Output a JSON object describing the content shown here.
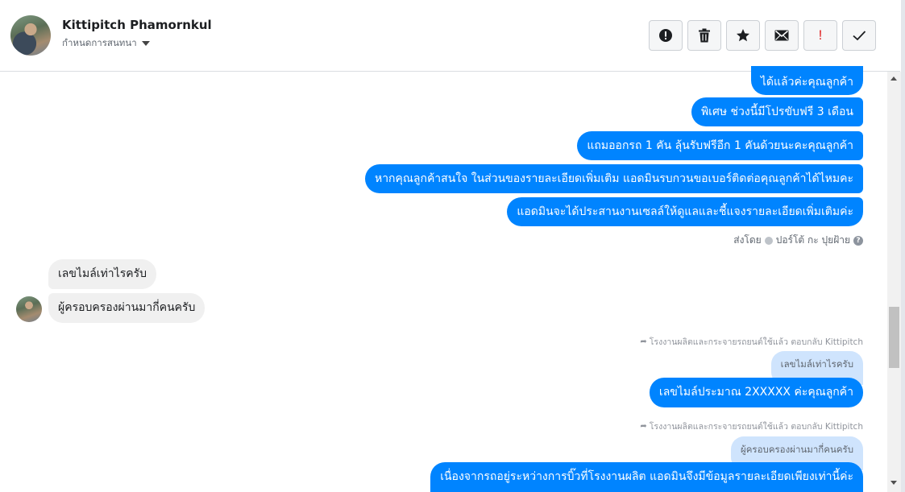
{
  "header": {
    "contact_name": "Kittipitch Phamornkul",
    "subtitle": "กำหนดการสนทนา"
  },
  "toolbar": {
    "buttons": [
      {
        "icon": "alert-circle-icon"
      },
      {
        "icon": "trash-icon"
      },
      {
        "icon": "star-icon"
      },
      {
        "icon": "envelope-icon"
      },
      {
        "icon": "exclamation-icon",
        "label": "!",
        "color": "#e02020"
      },
      {
        "icon": "checkmark-icon"
      }
    ]
  },
  "messages": {
    "outgoing_1": "ได้แล้วค่ะคุณลูกค้า",
    "outgoing_2": "พิเศษ ช่วงนี้มีโปรขับฟรี 3 เดือน",
    "outgoing_3": "แถมออกรถ 1 คัน ลุ้นรับฟรีอีก 1 คันด้วยนะคะคุณลูกค้า",
    "outgoing_4": "หากคุณลูกค้าสนใจ ในส่วนของรายละเอียดเพิ่มเติม แอดมินรบกวนขอเบอร์ติดต่อคุณลูกค้าได้ไหมคะ",
    "outgoing_5": "แอดมินจะได้ประสานงานเซลล์ให้ดูแลและชี้แจงรายละเอียดเพิ่มเติมค่ะ",
    "sent_by_prefix": "ส่งโดย",
    "sent_by_name": "ปอร์โต้ กะ ปุยฝ้าย",
    "incoming_1": "เลขไมล์เท่าไรครับ",
    "incoming_2": "ผู้ครอบครองผ่านมากี่คนครับ",
    "reply_note_1": "โรงงานผลิตและกระจายรถยนต์ใช้แล้ว ตอบกลับ Kittipitch",
    "reply_quote_1": "เลขไมล์เท่าไรครับ",
    "reply_answer_1": "เลขไมล์ประมาณ 2XXXXX ค่ะคุณลูกค้า",
    "reply_note_2": "โรงงานผลิตและกระจายรถยนต์ใช้แล้ว ตอบกลับ Kittipitch",
    "reply_quote_2": "ผู้ครอบครองผ่านมากี่คนครับ",
    "reply_answer_2": "เนื่องจากรถอยู่ระหว่างการบิ๊วที่โรงงานผลิต แอดมินจึงมีข้อมูลรายละเอียดเพียงเท่านี้ค่ะ"
  },
  "colors": {
    "outgoing_bubble": "#0084ff",
    "incoming_bubble": "#f0f0f0",
    "reply_quote_bg": "#cfe4fd"
  }
}
